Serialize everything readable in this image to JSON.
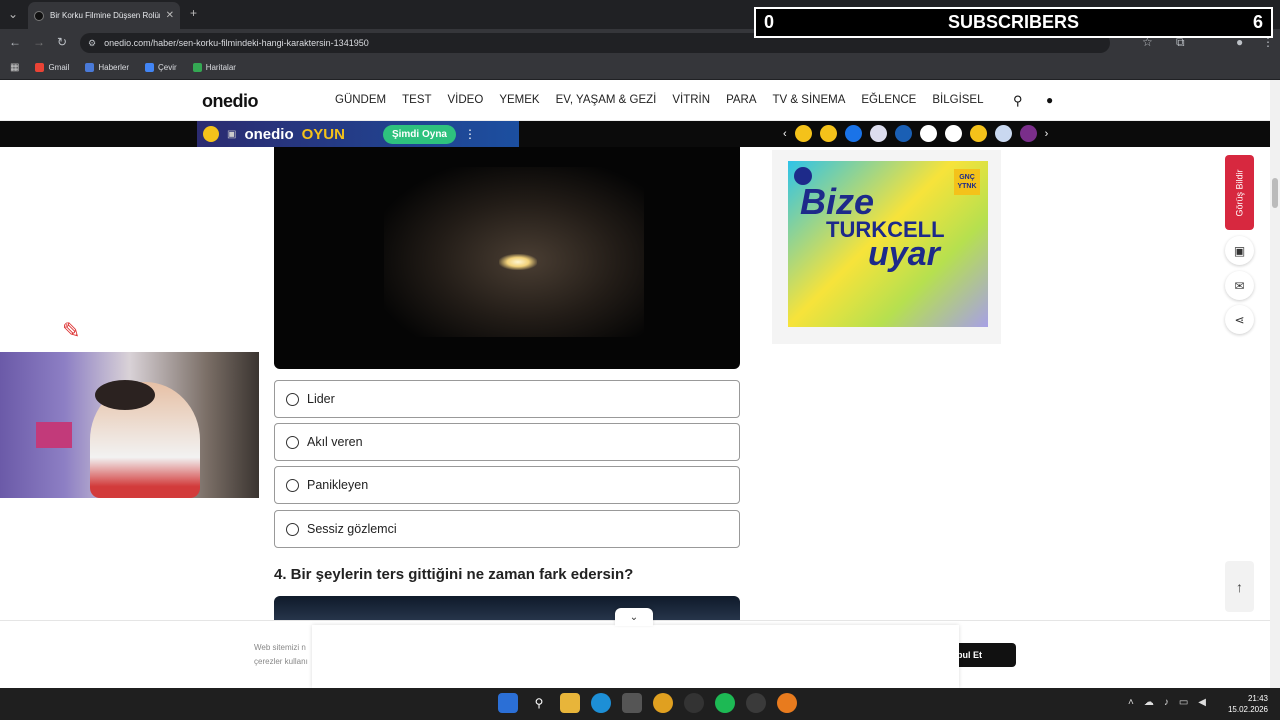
{
  "browser": {
    "tab_title": "Bir Korku Filmine Düşsen Rolün",
    "tab_close": "✕",
    "new_tab": "+",
    "url": "onedio.com/haber/sen-korku-filmindeki-hangi-karaktersin-1341950",
    "bookmarks": [
      "Gmail",
      "Haberler",
      "Çevir",
      "Haritalar"
    ]
  },
  "overlay": {
    "left_count": "0",
    "label": "SUBSCRIBERS",
    "right_count": "6"
  },
  "site": {
    "logo": "onedio",
    "menu": [
      "GÜNDEM",
      "TEST",
      "VİDEO",
      "YEMEK",
      "EV, YAŞAM & GEZİ",
      "VİTRİN",
      "PARA",
      "TV & SİNEMA",
      "EĞLENCE",
      "BİLGİSEL"
    ]
  },
  "game_banner": {
    "logo": "onedio",
    "oyun": "OYUN",
    "play_button": "Şimdi Oyna"
  },
  "quiz": {
    "options": [
      "Lider",
      "Akıl veren",
      "Panikleyen",
      "Sessiz gözlemci"
    ],
    "next_question": "4. Bir şeylerin ters gittiğini ne zaman fark edersin?"
  },
  "ad": {
    "line1": "Bize",
    "line2": "TURKCELL",
    "line3": "uyar",
    "badge": "GNÇ YTNK"
  },
  "side": {
    "feedback": "Görüş Bildir"
  },
  "cookie": {
    "text_line1": "Web sitemizi n",
    "text_line2": "çerezler kullanı",
    "accept": "bul Et"
  },
  "taskbar": {
    "time": "21:43",
    "date": "15.02.2026"
  },
  "colors": {
    "feedback_red": "#d7283f",
    "play_green": "#2ec27e",
    "oyun_yellow": "#f4c21a"
  }
}
